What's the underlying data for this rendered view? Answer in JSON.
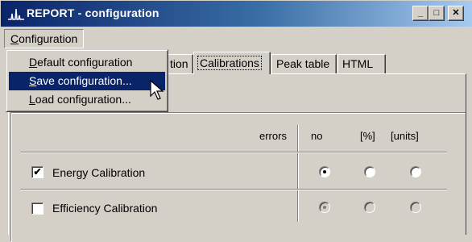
{
  "window": {
    "title": "REPORT - configuration",
    "controls": {
      "minimize": "_",
      "maximize": "□",
      "close": "✕"
    }
  },
  "menubar": {
    "configuration": {
      "label_u": "C",
      "label_rest": "onfiguration"
    }
  },
  "dropdown": {
    "items": [
      {
        "u": "D",
        "rest": "efault configuration",
        "highlighted": false
      },
      {
        "u": "S",
        "rest": "ave configuration...",
        "highlighted": true
      },
      {
        "u": "L",
        "rest": "oad configuration...",
        "highlighted": false
      }
    ]
  },
  "tabs": [
    {
      "label": "tion",
      "active": false
    },
    {
      "label": "Calibrations",
      "active": true
    },
    {
      "label": "Peak table",
      "active": false
    },
    {
      "label": "HTML",
      "active": false
    }
  ],
  "table": {
    "headers": {
      "errors": "errors",
      "no": "no",
      "pct": "[%]",
      "units": "[units]"
    },
    "rows": [
      {
        "label": "Energy Calibration",
        "checked": true,
        "checkmark": "✔",
        "selected": "no",
        "enabled": true
      },
      {
        "label": "Efficiency Calibration",
        "checked": false,
        "checkmark": "",
        "selected": "no",
        "enabled": false
      }
    ]
  },
  "colors": {
    "titlebar_start": "#0a246a",
    "titlebar_end": "#a6caf0",
    "face": "#d4d0c8",
    "highlight": "#0a246a"
  }
}
